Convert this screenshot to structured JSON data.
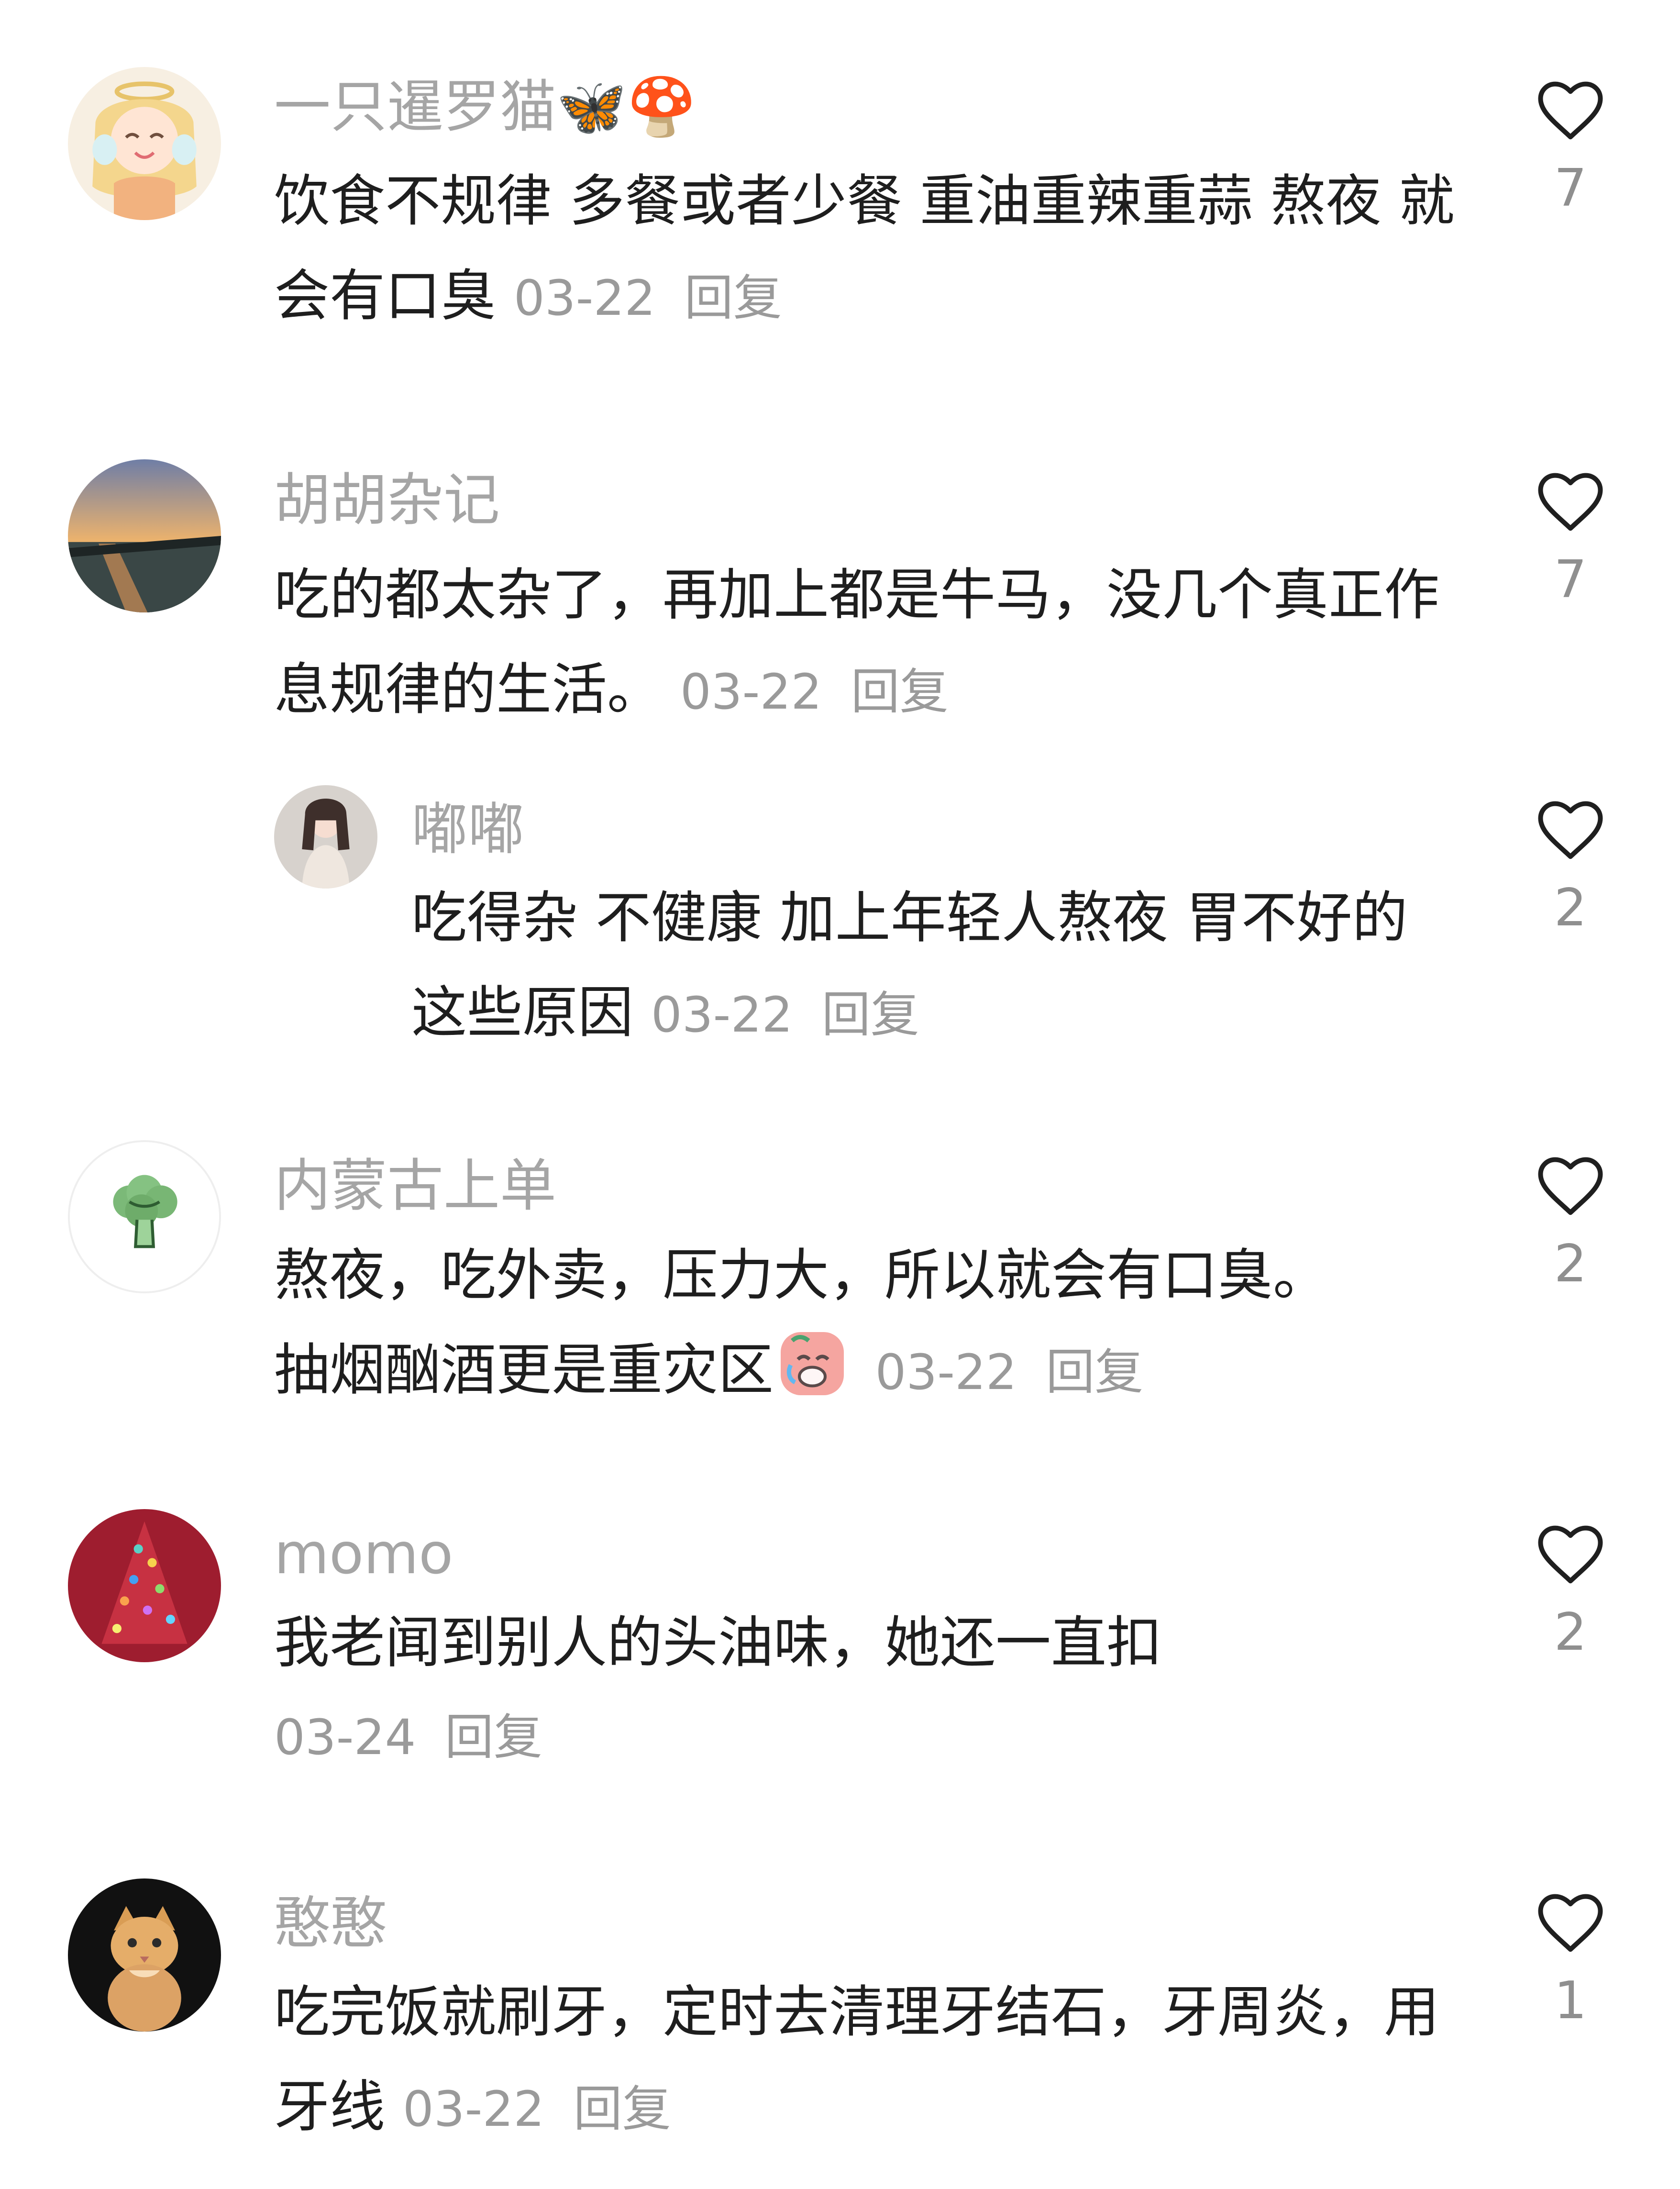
{
  "comments": [
    {
      "username": "一只暹罗猫🦋🍄",
      "text": "饮食不规律 多餐或者少餐 重油重辣重蒜 熬夜 就会有口臭",
      "date": "03-22",
      "reply_label": "回复",
      "likes": "7"
    },
    {
      "username": "胡胡杂记",
      "text": "吃的都太杂了，再加上都是牛马，没几个真正作息规律的生活。",
      "date": "03-22",
      "reply_label": "回复",
      "likes": "7"
    },
    {
      "username": "嘟嘟",
      "text": "吃得杂 不健康 加上年轻人熬夜 胃不好的 这些原因",
      "date": "03-22",
      "reply_label": "回复",
      "likes": "2"
    },
    {
      "username": "内蒙古上单",
      "text_line1": "熬夜，吃外卖，压力大，所以就会有口臭。",
      "text_line2": "抽烟酗酒更是重灾区",
      "date": "03-22",
      "reply_label": "回复",
      "likes": "2"
    },
    {
      "username": "momo",
      "text": "我老闻到别人的头油味，她还一直扣",
      "date": "03-24",
      "reply_label": "回复",
      "likes": "2"
    },
    {
      "username": "憨憨",
      "text": "吃完饭就刷牙，定时去清理牙结石，牙周炎，用牙线",
      "date": "03-22",
      "reply_label": "回复",
      "likes": "1"
    }
  ],
  "icons": {
    "like": "heart-outline-icon",
    "reply_emoji": "crying-face-emoji"
  },
  "colors": {
    "username": "#a5a5a5",
    "body_text": "#1e1e1e",
    "meta": "#9a9a9a",
    "heart_outline": "#1f1f1f"
  }
}
